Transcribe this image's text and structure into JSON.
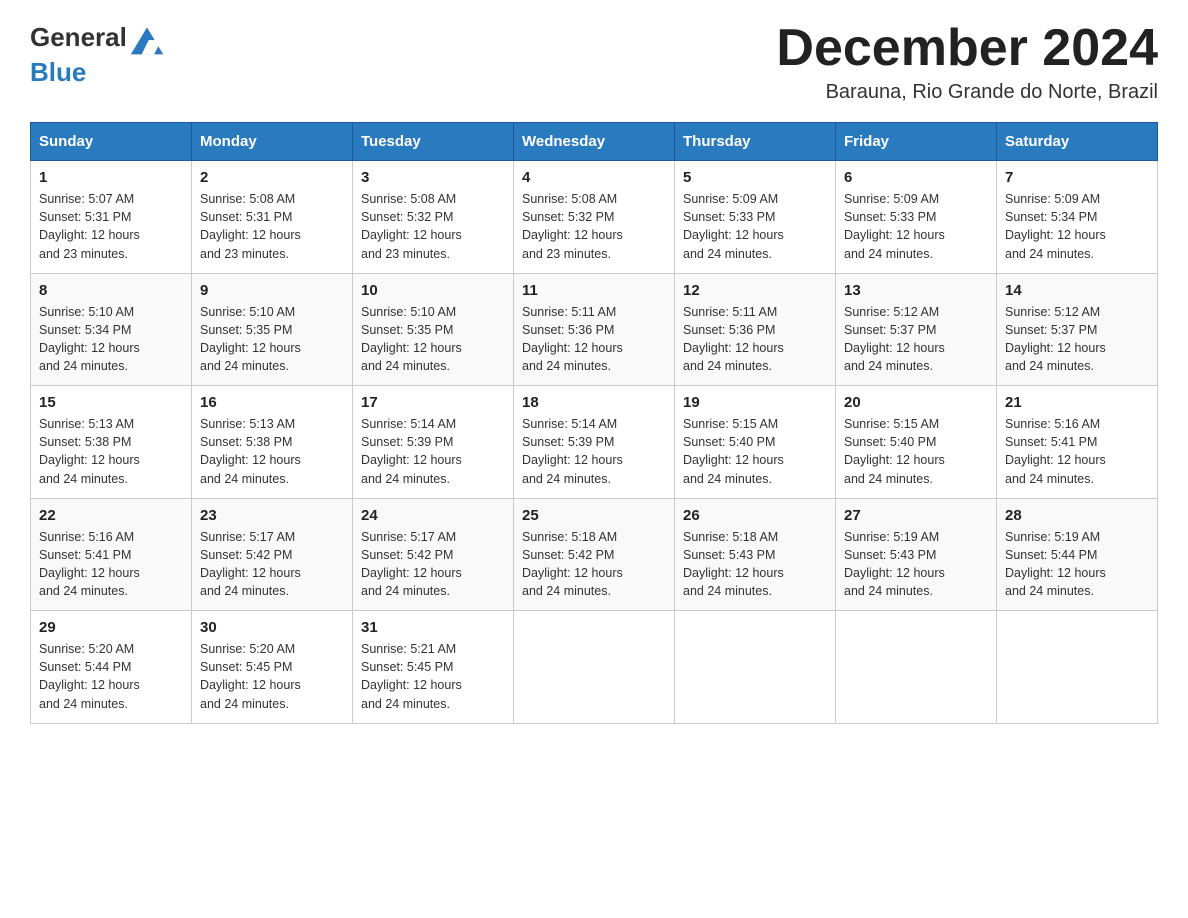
{
  "header": {
    "logo_general": "General",
    "logo_blue": "Blue",
    "month_title": "December 2024",
    "location": "Barauna, Rio Grande do Norte, Brazil"
  },
  "days_of_week": [
    "Sunday",
    "Monday",
    "Tuesday",
    "Wednesday",
    "Thursday",
    "Friday",
    "Saturday"
  ],
  "weeks": [
    [
      {
        "day": "1",
        "sunrise": "5:07 AM",
        "sunset": "5:31 PM",
        "daylight": "12 hours and 23 minutes."
      },
      {
        "day": "2",
        "sunrise": "5:08 AM",
        "sunset": "5:31 PM",
        "daylight": "12 hours and 23 minutes."
      },
      {
        "day": "3",
        "sunrise": "5:08 AM",
        "sunset": "5:32 PM",
        "daylight": "12 hours and 23 minutes."
      },
      {
        "day": "4",
        "sunrise": "5:08 AM",
        "sunset": "5:32 PM",
        "daylight": "12 hours and 23 minutes."
      },
      {
        "day": "5",
        "sunrise": "5:09 AM",
        "sunset": "5:33 PM",
        "daylight": "12 hours and 24 minutes."
      },
      {
        "day": "6",
        "sunrise": "5:09 AM",
        "sunset": "5:33 PM",
        "daylight": "12 hours and 24 minutes."
      },
      {
        "day": "7",
        "sunrise": "5:09 AM",
        "sunset": "5:34 PM",
        "daylight": "12 hours and 24 minutes."
      }
    ],
    [
      {
        "day": "8",
        "sunrise": "5:10 AM",
        "sunset": "5:34 PM",
        "daylight": "12 hours and 24 minutes."
      },
      {
        "day": "9",
        "sunrise": "5:10 AM",
        "sunset": "5:35 PM",
        "daylight": "12 hours and 24 minutes."
      },
      {
        "day": "10",
        "sunrise": "5:10 AM",
        "sunset": "5:35 PM",
        "daylight": "12 hours and 24 minutes."
      },
      {
        "day": "11",
        "sunrise": "5:11 AM",
        "sunset": "5:36 PM",
        "daylight": "12 hours and 24 minutes."
      },
      {
        "day": "12",
        "sunrise": "5:11 AM",
        "sunset": "5:36 PM",
        "daylight": "12 hours and 24 minutes."
      },
      {
        "day": "13",
        "sunrise": "5:12 AM",
        "sunset": "5:37 PM",
        "daylight": "12 hours and 24 minutes."
      },
      {
        "day": "14",
        "sunrise": "5:12 AM",
        "sunset": "5:37 PM",
        "daylight": "12 hours and 24 minutes."
      }
    ],
    [
      {
        "day": "15",
        "sunrise": "5:13 AM",
        "sunset": "5:38 PM",
        "daylight": "12 hours and 24 minutes."
      },
      {
        "day": "16",
        "sunrise": "5:13 AM",
        "sunset": "5:38 PM",
        "daylight": "12 hours and 24 minutes."
      },
      {
        "day": "17",
        "sunrise": "5:14 AM",
        "sunset": "5:39 PM",
        "daylight": "12 hours and 24 minutes."
      },
      {
        "day": "18",
        "sunrise": "5:14 AM",
        "sunset": "5:39 PM",
        "daylight": "12 hours and 24 minutes."
      },
      {
        "day": "19",
        "sunrise": "5:15 AM",
        "sunset": "5:40 PM",
        "daylight": "12 hours and 24 minutes."
      },
      {
        "day": "20",
        "sunrise": "5:15 AM",
        "sunset": "5:40 PM",
        "daylight": "12 hours and 24 minutes."
      },
      {
        "day": "21",
        "sunrise": "5:16 AM",
        "sunset": "5:41 PM",
        "daylight": "12 hours and 24 minutes."
      }
    ],
    [
      {
        "day": "22",
        "sunrise": "5:16 AM",
        "sunset": "5:41 PM",
        "daylight": "12 hours and 24 minutes."
      },
      {
        "day": "23",
        "sunrise": "5:17 AM",
        "sunset": "5:42 PM",
        "daylight": "12 hours and 24 minutes."
      },
      {
        "day": "24",
        "sunrise": "5:17 AM",
        "sunset": "5:42 PM",
        "daylight": "12 hours and 24 minutes."
      },
      {
        "day": "25",
        "sunrise": "5:18 AM",
        "sunset": "5:42 PM",
        "daylight": "12 hours and 24 minutes."
      },
      {
        "day": "26",
        "sunrise": "5:18 AM",
        "sunset": "5:43 PM",
        "daylight": "12 hours and 24 minutes."
      },
      {
        "day": "27",
        "sunrise": "5:19 AM",
        "sunset": "5:43 PM",
        "daylight": "12 hours and 24 minutes."
      },
      {
        "day": "28",
        "sunrise": "5:19 AM",
        "sunset": "5:44 PM",
        "daylight": "12 hours and 24 minutes."
      }
    ],
    [
      {
        "day": "29",
        "sunrise": "5:20 AM",
        "sunset": "5:44 PM",
        "daylight": "12 hours and 24 minutes."
      },
      {
        "day": "30",
        "sunrise": "5:20 AM",
        "sunset": "5:45 PM",
        "daylight": "12 hours and 24 minutes."
      },
      {
        "day": "31",
        "sunrise": "5:21 AM",
        "sunset": "5:45 PM",
        "daylight": "12 hours and 24 minutes."
      },
      null,
      null,
      null,
      null
    ]
  ]
}
